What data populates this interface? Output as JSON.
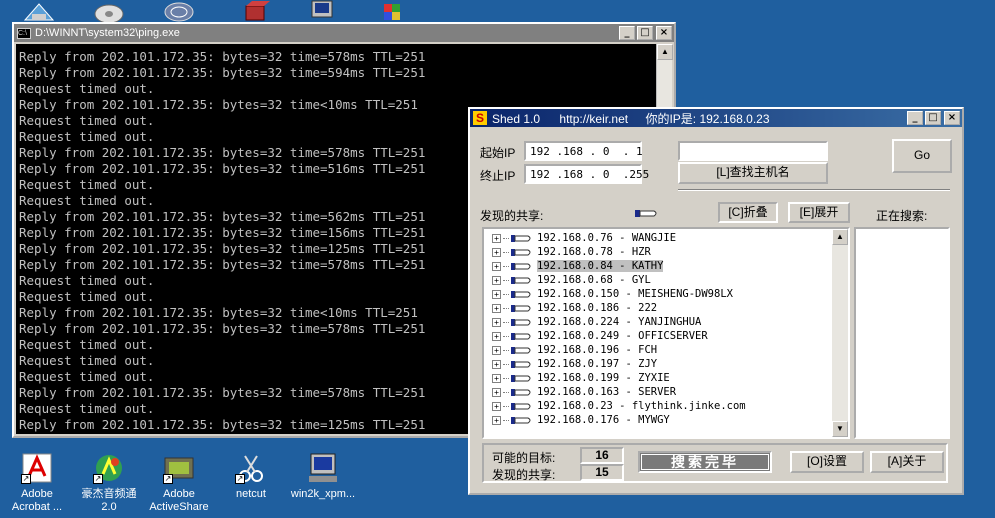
{
  "desktop_top_icons": [
    "folder-icon",
    "disk-icon",
    "network-icon",
    "box-icon",
    "computer-icon",
    "cube-icon"
  ],
  "desktop_icons": [
    {
      "label": "Adobe\nAcrobat ...",
      "icon": "acrobat-icon"
    },
    {
      "label": "豪杰音频通\n2.0",
      "icon": "audio-icon"
    },
    {
      "label": "Adobe\nActiveShare",
      "icon": "activeshare-icon"
    },
    {
      "label": "netcut",
      "icon": "netcut-icon"
    },
    {
      "label": "win2k_xpm...",
      "icon": "installer-icon"
    }
  ],
  "cmd": {
    "title": "D:\\WINNT\\system32\\ping.exe",
    "lines": [
      "Reply from 202.101.172.35: bytes=32 time=578ms TTL=251",
      "Reply from 202.101.172.35: bytes=32 time=594ms TTL=251",
      "Request timed out.",
      "Reply from 202.101.172.35: bytes=32 time<10ms TTL=251",
      "Request timed out.",
      "Request timed out.",
      "Reply from 202.101.172.35: bytes=32 time=578ms TTL=251",
      "Reply from 202.101.172.35: bytes=32 time=516ms TTL=251",
      "Request timed out.",
      "Request timed out.",
      "Reply from 202.101.172.35: bytes=32 time=562ms TTL=251",
      "Reply from 202.101.172.35: bytes=32 time=156ms TTL=251",
      "Reply from 202.101.172.35: bytes=32 time=125ms TTL=251",
      "Reply from 202.101.172.35: bytes=32 time=578ms TTL=251",
      "Request timed out.",
      "Request timed out.",
      "Reply from 202.101.172.35: bytes=32 time<10ms TTL=251",
      "Reply from 202.101.172.35: bytes=32 time=578ms TTL=251",
      "Request timed out.",
      "Request timed out.",
      "Request timed out.",
      "Reply from 202.101.172.35: bytes=32 time=578ms TTL=251",
      "Request timed out.",
      "Reply from 202.101.172.35: bytes=32 time=125ms TTL=251"
    ]
  },
  "shed": {
    "title": "Shed 1.0",
    "url": "http://keir.net",
    "myip": "你的IP是: 192.168.0.23",
    "start_label": "起始IP",
    "start_ip": "192 .168 . 0  . 1",
    "end_label": "终止IP",
    "end_ip": "192 .168 . 0  .255",
    "lookup_field": "",
    "lookup_button": "[L]查找主机名",
    "go_button": "Go",
    "found_label": "发现的共享:",
    "collapse_button": "[C]折叠",
    "expand_button": "[E]展开",
    "searching_label": "正在搜索:",
    "shares": [
      "192.168.0.76 - WANGJIE",
      "192.168.0.78 - HZR",
      "192.168.0.84 - KATHY",
      "192.168.0.68 - GYL",
      "192.168.0.150 - MEISHENG-DW98LX",
      "192.168.0.186 - 222",
      "192.168.0.224 - YANJINGHUA",
      "192.168.0.249 - OFFICSERVER",
      "192.168.0.196 - FCH",
      "192.168.0.197 - ZJY",
      "192.168.0.199 - ZYXIE",
      "192.168.0.163 - SERVER",
      "192.168.0.23 - flythink.jinke.com",
      "192.168.0.176 - MYWGY"
    ],
    "selected_index": 2,
    "possible_targets_label": "可能的目标:",
    "possible_targets": "16",
    "found_shares_label": "发现的共享:",
    "found_shares": "15",
    "status": "搜索完毕",
    "settings_button": "[O]设置",
    "about_button": "[A]关于"
  }
}
